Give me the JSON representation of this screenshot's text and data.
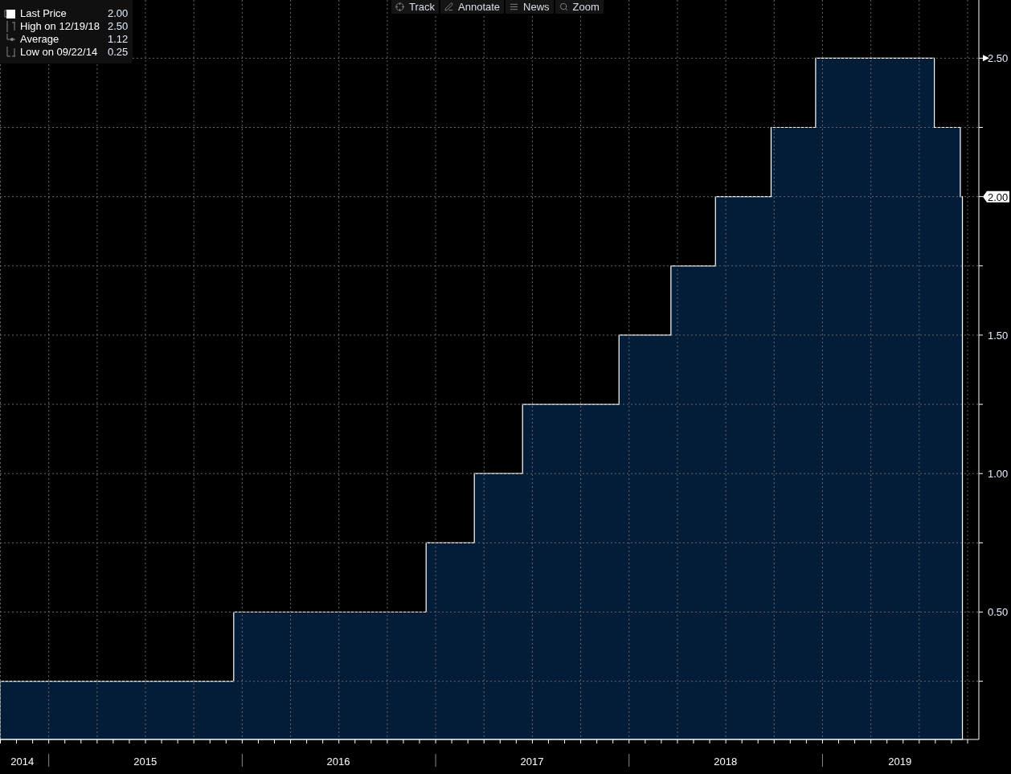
{
  "toolbar": [
    {
      "kind": "track",
      "label": "Track"
    },
    {
      "kind": "annotate",
      "label": "Annotate"
    },
    {
      "kind": "news",
      "label": "News"
    },
    {
      "kind": "zoom",
      "label": "Zoom"
    }
  ],
  "legend": [
    {
      "kind": "last",
      "value": "2.00"
    },
    {
      "kind": "high",
      "label": "High on 12/19/18",
      "value": "2.50"
    },
    {
      "kind": "average",
      "label": "Average",
      "value": "1.12"
    },
    {
      "kind": "low",
      "label": "Low on 09/22/14",
      "value": "0.25"
    }
  ],
  "chart_data": {
    "type": "area",
    "xlim": [
      "2014-10-01",
      "2019-10-23"
    ],
    "ylim": [
      0.04,
      2.71
    ],
    "grid": true,
    "x": [
      "2014-10-01",
      "2015-12-16",
      "2016-12-14",
      "2017-03-15",
      "2017-06-14",
      "2017-12-13",
      "2018-03-21",
      "2018-06-13",
      "2018-09-26",
      "2018-12-19",
      "2019-07-31",
      "2019-09-18",
      "2019-09-22"
    ],
    "series": [
      {
        "name": "Last Price",
        "color": "#031d38",
        "values": [
          0.25,
          0.5,
          0.75,
          1.0,
          1.25,
          1.5,
          1.75,
          2.0,
          2.25,
          2.5,
          2.25,
          2.0,
          2.0
        ]
      }
    ],
    "xticks": [
      {
        "value": "2014-11-12",
        "label": "2014"
      },
      {
        "value": "2015-07-02",
        "label": "2015"
      },
      {
        "value": "2016-07-01",
        "label": "2016"
      },
      {
        "value": "2017-07-02",
        "label": "2017"
      },
      {
        "value": "2018-07-02",
        "label": "2018"
      },
      {
        "value": "2019-05-27",
        "label": "2019"
      }
    ],
    "yticks": [
      {
        "value": 0.5,
        "label": "0.50"
      },
      {
        "value": 1.0,
        "label": "1.00"
      },
      {
        "value": 1.5,
        "label": "1.50"
      },
      {
        "value": 2.0,
        "label": "2.00"
      },
      {
        "value": 2.5,
        "label": "2.50"
      }
    ]
  }
}
